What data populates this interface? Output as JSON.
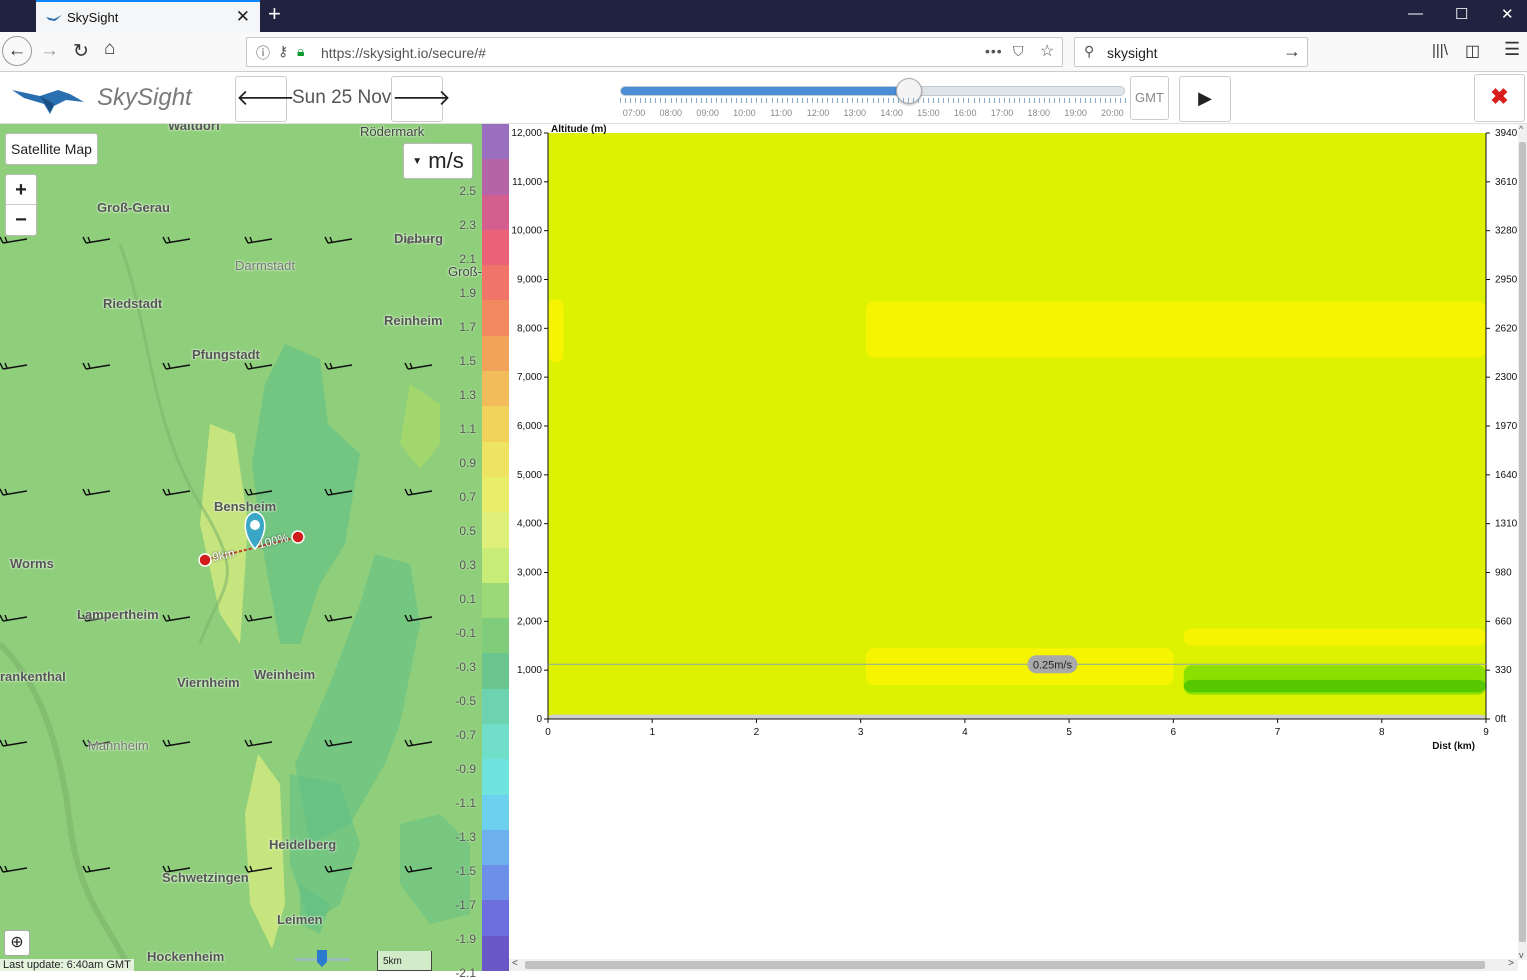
{
  "browser": {
    "tab_title": "SkySight",
    "url": "https://skysight.io/secure/#",
    "search_value": "skysight"
  },
  "app": {
    "logo_text": "SkySight",
    "date_label": "Sun 25 Nov",
    "time_labels": [
      "07:00",
      "08:00",
      "09:00",
      "10:00",
      "11:00",
      "12:00",
      "13:00",
      "14:00",
      "15:00",
      "16:00",
      "17:00",
      "18:00",
      "19:00",
      "20:00"
    ],
    "time_slider_position": 0.57,
    "timezone_label": "GMT"
  },
  "map": {
    "satellite_button": "Satellite Map",
    "zoom_in": "+",
    "zoom_out": "−",
    "unit_selector": "m/s",
    "route_distance_label": "9km",
    "route_percent_label": "100%",
    "scale_label": "5km",
    "last_update": "Last update: 6:40am GMT",
    "towns": [
      "Rödermark",
      "Groß-Gerau",
      "Dieburg",
      "Darmstadt",
      "Groß-",
      "Riedstadt",
      "Reinheim",
      "Pfungstadt",
      "Bensheim",
      "Worms",
      "Lampertheim",
      "rankenthal",
      "Viernheim",
      "Weinheim",
      "Mannheim",
      "Heidelberg",
      "Schwetzingen",
      "Leimen",
      "Hockenheim",
      "Waltdorf"
    ]
  },
  "legend": {
    "values": [
      "2.5",
      "2.3",
      "2.1",
      "1.9",
      "1.7",
      "1.5",
      "1.3",
      "1.1",
      "0.9",
      "0.7",
      "0.5",
      "0.3",
      "0.1",
      "-0.1",
      "-0.3",
      "-0.5",
      "-0.7",
      "-0.9",
      "-1.1",
      "-1.3",
      "-1.5",
      "-1.7",
      "-1.9",
      "-2.1"
    ],
    "colors": [
      "#9a6fc0",
      "#b664a8",
      "#d45e8e",
      "#e96277",
      "#f07468",
      "#f38a5f",
      "#f3a45a",
      "#f2bc5a",
      "#f1d35c",
      "#eee362",
      "#e8ee6a",
      "#dff07a",
      "#c7ec78",
      "#9bd978",
      "#7fcd7a",
      "#6bc58e",
      "#6dd2b0",
      "#70dec8",
      "#6fe4de",
      "#6dd0ee",
      "#6cb0ee",
      "#6c8fe8",
      "#6e6fde",
      "#6a58c8"
    ]
  },
  "chart_data": {
    "type": "heatmap",
    "ylabel_left": "Altitude (m)",
    "xlabel": "Dist (km)",
    "x_ticks": [
      "0",
      "1",
      "2",
      "3",
      "4",
      "5",
      "6",
      "7",
      "8",
      "9"
    ],
    "y_ticks_left": [
      "0",
      "1,000",
      "2,000",
      "3,000",
      "4,000",
      "5,000",
      "6,000",
      "7,000",
      "8,000",
      "9,000",
      "10,000",
      "11,000",
      "12,000"
    ],
    "y_ticks_right": [
      "0ft",
      "330",
      "660",
      "980",
      "1310",
      "1640",
      "1970",
      "2300",
      "2620",
      "2950",
      "3280",
      "3610",
      "3940"
    ],
    "xlim": [
      0,
      9
    ],
    "ylim": [
      0,
      12000
    ],
    "cursor_label": "0.25m/s",
    "cursor_altitude": 1120,
    "background_color": "#dcf200",
    "regions": [
      {
        "x0": 0,
        "x1": 0.15,
        "y0": 7300,
        "y1": 8600,
        "color": "#f6f400"
      },
      {
        "x0": 3.05,
        "x1": 9,
        "y0": 7400,
        "y1": 8550,
        "color": "#f6f400"
      },
      {
        "x0": 3.05,
        "x1": 6.0,
        "y0": 700,
        "y1": 1450,
        "color": "#f6f400"
      },
      {
        "x0": 6.1,
        "x1": 9,
        "y0": 1500,
        "y1": 1850,
        "color": "#f6f400"
      },
      {
        "x0": 6.1,
        "x1": 9,
        "y0": 500,
        "y1": 1100,
        "color": "#8be000"
      },
      {
        "x0": 6.1,
        "x1": 9,
        "y0": 550,
        "y1": 800,
        "color": "#55c800"
      },
      {
        "x0": 0,
        "x1": 9,
        "y0": 0,
        "y1": 90,
        "color": "#cfcfcf"
      }
    ]
  }
}
